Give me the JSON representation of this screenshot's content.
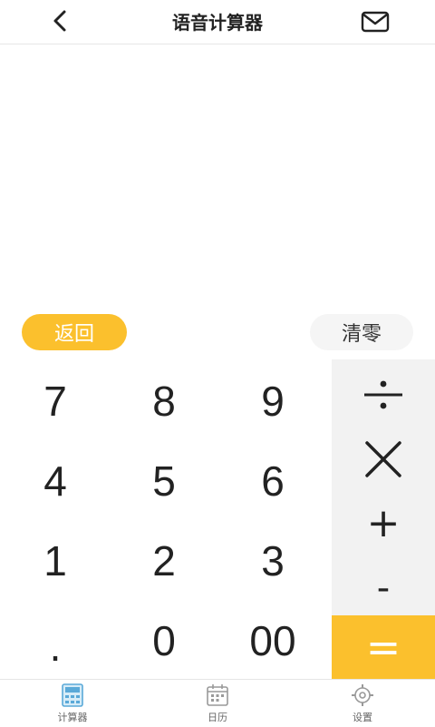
{
  "header": {
    "title": "语音计算器"
  },
  "controls": {
    "back_label": "返回",
    "clear_label": "清零"
  },
  "keypad": {
    "row1": [
      "7",
      "8",
      "9"
    ],
    "row2": [
      "4",
      "5",
      "6"
    ],
    "row3": [
      "1",
      "2",
      "3"
    ],
    "row4": [
      ".",
      "0",
      "00"
    ]
  },
  "operators": {
    "add": "+",
    "subtract": "-",
    "equals": "="
  },
  "tabs": [
    {
      "label": "计算器",
      "icon": "calculator-icon"
    },
    {
      "label": "日历",
      "icon": "calendar-icon"
    },
    {
      "label": "设置",
      "icon": "settings-icon"
    }
  ],
  "colors": {
    "accent": "#fbc02d",
    "op_bg": "#f2f2f2",
    "text": "#222222",
    "active_tab": "#5aa9d8"
  }
}
